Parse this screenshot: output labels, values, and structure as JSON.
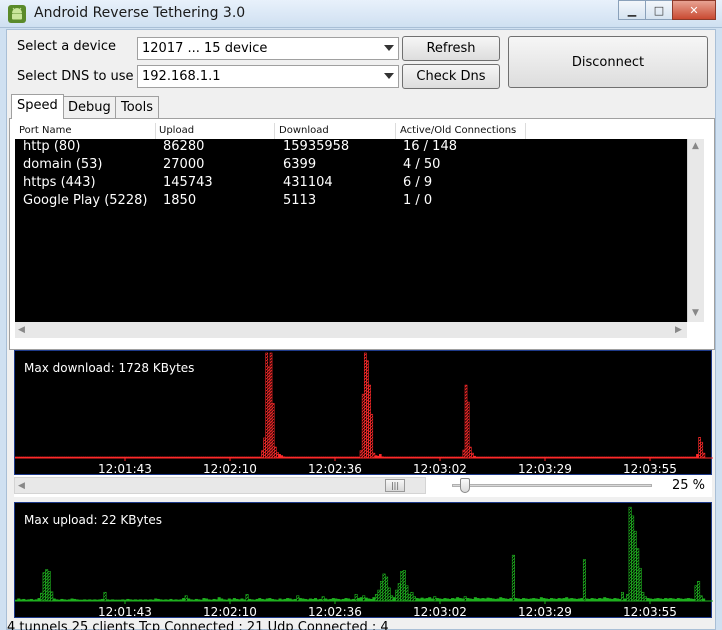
{
  "window": {
    "title": "Android Reverse Tethering 3.0",
    "min_glyph": "▁",
    "max_glyph": "□",
    "close_glyph": "✕"
  },
  "controls": {
    "device_label": "Select a device",
    "device_value": "12017 ... 15  device",
    "dns_label": "Select DNS to use",
    "dns_value": "192.168.1.1",
    "refresh_label": "Refresh",
    "check_dns_label": "Check Dns",
    "disconnect_label": "Disconnect"
  },
  "tabs": [
    {
      "label": "Speed",
      "active": true
    },
    {
      "label": "Debug",
      "active": false
    },
    {
      "label": "Tools",
      "active": false
    }
  ],
  "table": {
    "columns": [
      "Port Name",
      "Upload",
      "Download",
      "Active/Old Connections"
    ],
    "rows": [
      [
        "http (80)",
        "86280",
        "15935958",
        "16 / 148"
      ],
      [
        "domain (53)",
        "27000",
        "6399",
        "4 / 50"
      ],
      [
        "https (443)",
        "145743",
        "431104",
        "6 / 9"
      ],
      [
        "Google Play (5228)",
        "1850",
        "5113",
        "1 / 0"
      ]
    ]
  },
  "download_chart": {
    "title": "Max download: 1728 KBytes",
    "color": "#ff2a2a",
    "ticks": [
      "12:01:43",
      "12:02:10",
      "12:02:36",
      "12:03:02",
      "12:03:29",
      "12:03:55"
    ]
  },
  "upload_chart": {
    "title": "Max upload: 22 KBytes",
    "color": "#1fb01f",
    "ticks": [
      "12:01:43",
      "12:02:10",
      "12:02:36",
      "12:03:02",
      "12:03:29",
      "12:03:55"
    ]
  },
  "zoom": {
    "value": "25 %",
    "fraction": 0.04
  },
  "status": {
    "text": "4 tunnels 25 clients Tcp Connected : 21 Udp Connected : 4"
  },
  "chart_data": [
    {
      "type": "bar",
      "title": "Max download: 1728 KBytes",
      "x_ticks": [
        "12:01:43",
        "12:02:10",
        "12:02:36",
        "12:03:02",
        "12:03:29",
        "12:03:55"
      ],
      "ylim": [
        0,
        1728
      ],
      "series": [
        {
          "values": [
            2,
            1,
            1,
            2,
            1,
            1,
            1,
            1,
            1,
            1,
            1,
            1,
            1,
            1,
            1,
            2,
            1,
            1,
            1,
            1,
            1,
            1,
            1,
            1,
            1,
            1,
            1,
            1,
            1,
            1,
            1,
            1,
            1,
            1,
            1,
            1,
            1,
            1,
            1,
            1,
            1,
            1,
            1,
            1,
            1,
            1,
            1,
            1,
            1,
            1,
            1,
            1,
            1,
            1,
            1,
            1,
            2,
            1,
            1,
            1,
            1,
            1,
            1,
            1,
            1,
            1,
            2,
            1,
            2,
            1,
            3,
            1,
            2,
            3,
            2,
            3,
            1,
            1,
            2,
            1,
            2,
            3,
            2,
            1,
            2,
            1,
            8,
            2,
            3,
            1,
            4,
            2,
            2,
            3,
            2,
            4,
            1,
            2,
            2,
            3,
            1,
            2,
            1,
            2,
            3,
            5,
            2,
            1,
            1,
            3,
            1,
            2,
            1,
            2,
            3,
            120,
            330,
            1728,
            1500,
            1728,
            900,
            180,
            90,
            60,
            40,
            20,
            15,
            10,
            8,
            6,
            5,
            4,
            3,
            4,
            3,
            2,
            3,
            2,
            3,
            2,
            4,
            3,
            2,
            1,
            2,
            3,
            2,
            2,
            3,
            2,
            1,
            2,
            3,
            5,
            4,
            2,
            1,
            2,
            3,
            2,
            3,
            120,
            1050,
            1728,
            1600,
            1200,
            720,
            80,
            40,
            30,
            60,
            20,
            10,
            6,
            5,
            4,
            3,
            5,
            6,
            4,
            3,
            2,
            3,
            4,
            3,
            2,
            3,
            2,
            1,
            2,
            3,
            4,
            3,
            2,
            1,
            2,
            3,
            2,
            3,
            2,
            1,
            2,
            3,
            2,
            5,
            4,
            3,
            2,
            1,
            130,
            1200,
            920,
            180,
            80,
            30,
            10,
            5,
            3,
            2,
            1,
            2,
            3,
            2,
            1,
            2,
            1,
            2,
            3,
            2,
            1,
            1,
            2,
            1,
            1,
            1,
            2,
            1,
            1,
            1,
            2,
            1,
            1,
            1,
            1,
            2,
            1,
            1,
            1,
            1,
            1,
            2,
            1,
            1,
            1,
            1,
            1,
            1,
            1,
            1,
            1,
            1,
            1,
            2,
            1,
            1,
            1,
            1,
            1,
            1,
            1,
            1,
            1,
            1,
            1,
            1,
            1,
            1,
            1,
            1,
            1,
            1,
            1,
            1,
            1,
            1,
            1,
            1,
            1,
            1,
            1,
            1,
            1,
            1,
            1,
            1,
            2,
            1,
            1,
            1,
            1,
            1,
            1,
            1,
            1,
            1,
            1,
            1,
            2,
            1,
            1,
            1,
            1,
            1,
            1,
            1,
            1,
            1,
            2,
            60,
            340,
            260,
            80
          ]
        }
      ]
    },
    {
      "type": "bar",
      "title": "Max upload: 22 KBytes",
      "x_ticks": [
        "12:01:43",
        "12:02:10",
        "12:02:36",
        "12:03:02",
        "12:03:29",
        "12:03:55"
      ],
      "ylim": [
        0,
        22
      ],
      "series": [
        {
          "values": [
            0.2,
            0.5,
            0.3,
            0.4,
            0.2,
            0.3,
            0.4,
            0.2,
            0.3,
            0.6,
            1.8,
            6.5,
            7.2,
            6.8,
            2.1,
            0.5,
            0.3,
            0.2,
            0.4,
            0.3,
            0.2,
            0.3,
            0.5,
            0.4,
            0.3,
            0.2,
            0.2,
            0.3,
            0.2,
            0.3,
            0.2,
            0.3,
            0.2,
            0.3,
            0.4,
            2.0,
            0.3,
            0.2,
            0.3,
            0.2,
            0.1,
            0.2,
            0.3,
            0.2,
            0.4,
            0.3,
            0.2,
            0.3,
            0.2,
            0.3,
            0.2,
            0.3,
            0.2,
            0.3,
            0.2,
            0.5,
            0.4,
            0.3,
            0.2,
            0.3,
            0.2,
            0.4,
            0.2,
            0.3,
            0.2,
            0.3,
            0.6,
            1.2,
            0.5,
            0.3,
            0.2,
            0.4,
            0.3,
            0.2,
            0.6,
            0.5,
            0.3,
            0.2,
            0.4,
            0.3,
            0.8,
            0.5,
            0.3,
            0.2,
            0.5,
            0.3,
            0.6,
            0.4,
            0.3,
            0.5,
            0.3,
            1.5,
            0.4,
            0.3,
            0.2,
            0.4,
            0.6,
            0.4,
            0.3,
            0.5,
            0.6,
            0.4,
            0.3,
            0.2,
            0.5,
            0.3,
            0.4,
            0.6,
            0.5,
            0.3,
            0.4,
            1.2,
            0.6,
            0.5,
            0.4,
            0.3,
            0.5,
            0.4,
            0.6,
            0.3,
            0.4,
            1.0,
            0.5,
            0.3,
            0.4,
            0.6,
            0.5,
            0.4,
            0.3,
            0.4,
            0.6,
            0.5,
            0.3,
            0.4,
            1.5,
            0.6,
            0.8,
            1.2,
            0.7,
            0.5,
            0.4,
            0.8,
            1.5,
            2.5,
            4.5,
            6.2,
            5.5,
            3.0,
            1.2,
            0.8,
            2.5,
            4.0,
            6.8,
            7.0,
            3.5,
            1.5,
            2.0,
            1.0,
            0.6,
            0.5,
            0.7,
            0.5,
            0.6,
            0.8,
            0.5,
            1.0,
            0.6,
            0.5,
            0.4,
            0.6,
            0.5,
            0.4,
            0.6,
            0.5,
            0.8,
            0.6,
            0.5,
            1.0,
            0.6,
            0.5,
            0.4,
            0.8,
            0.6,
            0.5,
            0.6,
            0.5,
            0.7,
            0.6,
            0.5,
            0.4,
            0.5,
            0.8,
            0.6,
            0.5,
            0.4,
            0.6,
            10.5,
            0.6,
            0.5,
            0.4,
            0.6,
            0.5,
            0.4,
            0.5,
            0.6,
            0.5,
            0.4,
            0.8,
            0.6,
            0.5,
            0.4,
            0.6,
            0.5,
            0.4,
            0.6,
            0.5,
            0.6,
            0.8,
            0.5,
            0.6,
            0.5,
            0.4,
            0.5,
            0.6,
            9.5,
            0.5,
            0.4,
            0.6,
            0.5,
            0.4,
            0.6,
            0.5,
            0.8,
            0.6,
            0.5,
            0.4,
            0.6,
            0.5,
            0.4,
            2.0,
            0.5,
            1.5,
            21.5,
            19.5,
            16.0,
            12.0,
            7.5,
            2.0,
            1.0,
            0.6,
            0.5,
            0.4,
            0.5,
            0.6,
            0.5,
            0.4,
            0.6,
            0.5,
            0.6,
            0.5,
            0.4,
            0.6,
            0.5,
            0.4,
            0.5,
            0.6,
            0.5,
            0.4,
            3.5,
            4.5,
            1.2,
            0.5
          ]
        }
      ]
    }
  ]
}
